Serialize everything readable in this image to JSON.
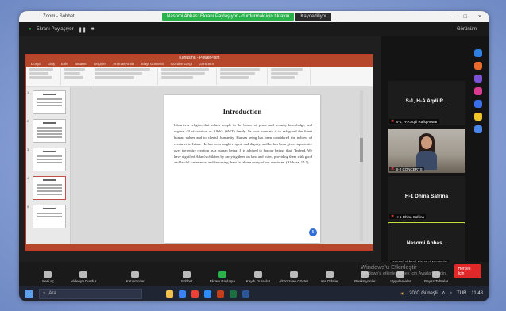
{
  "titlebar": {
    "app_name": "Zoom - Sohbet",
    "share_status": "Nasomi Abbas: Ekranı Paylaşıyor - durdurmak için tıklayın",
    "recording": "Kaydediliyor",
    "minimize": "—",
    "maximize": "□",
    "close": "×"
  },
  "zoomtop": {
    "share_label": "Ekranı Paylaşıyor",
    "view_label": "Görünüm"
  },
  "ppt": {
    "window_title": "Konusma - PowerPoint",
    "tabs": [
      "Dosya",
      "Giriş",
      "Ekle",
      "Tasarım",
      "Geçişler",
      "Animasyonlar",
      "Slayt Gösterisi",
      "Gözden Geçir",
      "Görünüm"
    ]
  },
  "slide": {
    "title": "Introduction",
    "body": "Islam is a religion that values people in the bearer of peace and security knowledge, and regards all of creation as Allah's (SWT) family. Its core mandate is to safeguard the finest human values and to cherish humanity. Human being has been considered the noblest of creatures in Islam. He has been taught respect and dignity, and he has been given superiority over the entire creation as a human being. It is advised to honour beings that: \"Indeed, We have dignified Adam's children by carrying them on land and water, providing them with good and lawful sustenance, and favouring them far above many of our creatures. (Al-Israa, 17:7)",
    "badge": "5"
  },
  "thumbnails": [
    {
      "num": "1"
    },
    {
      "num": "2"
    },
    {
      "num": "3"
    },
    {
      "num": "4"
    },
    {
      "num": "5"
    }
  ],
  "participants": [
    {
      "name": "S-1, H-A Aqdi R...",
      "tag": "S-1, H-A Aqdi Rafiq Anwar"
    },
    {
      "name": "",
      "tag": "S-2 CONCERTS"
    },
    {
      "name": "H-1 Dhina Safrina",
      "tag": "H-1 Dhina Safrina"
    },
    {
      "name": "Nasomi Abbas...",
      "tag": "Nasomi Abbas | Siraat-ul-Mustakim"
    }
  ],
  "toolbar": {
    "items": [
      "Sesi aç",
      "Videoyu Durdur",
      "Katılımcılar",
      "Sohbet",
      "Ekranı Paylaşın",
      "Kaydı Duraklat",
      "Alt Yazıları Göster",
      "Ara Odalar",
      "Reaksiyonlar",
      "Uygulamalar",
      "Beyaz Tahtalar"
    ],
    "leave": "Herkes İçin",
    "watermark_line1": "Windows'u Etkinleştir",
    "watermark_line2": "Windows'u etkinleştirmek için Ayarlar'a gidin."
  },
  "taskbar": {
    "search_placeholder": "Ara",
    "weather": "20°C Güneşli",
    "lang": "TUR",
    "time": "11:48"
  },
  "colors": {
    "ppt_accent": "#b7472a",
    "zoom_green": "#29b24a",
    "active_border": "#c8e03a"
  }
}
